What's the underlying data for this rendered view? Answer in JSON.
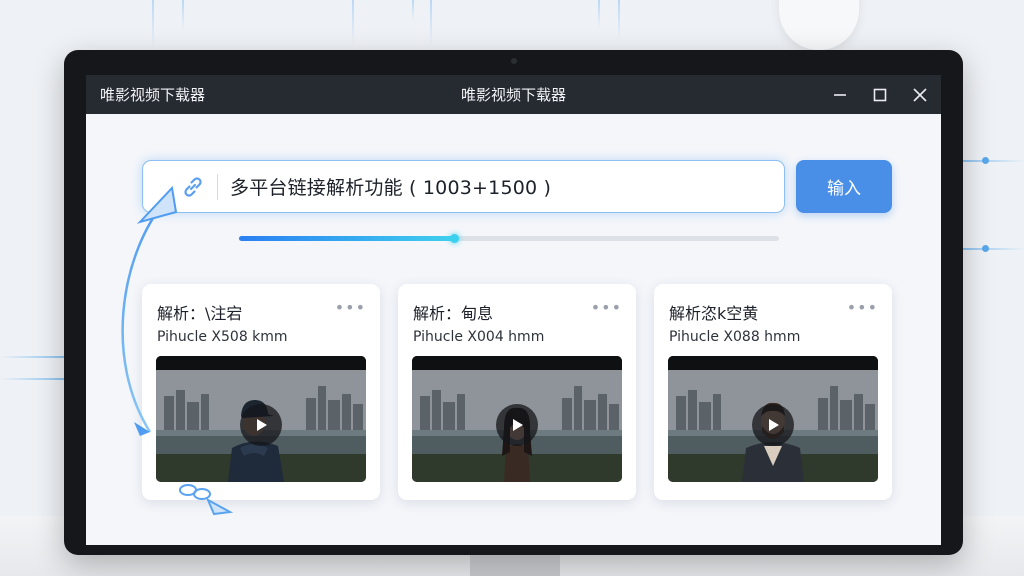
{
  "window": {
    "app_name": "唯影视频下载器",
    "title": "唯影视频下载器"
  },
  "search": {
    "value": "多平台链接解析功能 ( 1003+1500 )",
    "link_icon": "link-icon",
    "submit_label": "输入"
  },
  "progress": {
    "percent": 40
  },
  "cards": [
    {
      "title": "解析：\\注宕",
      "subtitle": "Pihucle X508 kmm",
      "more": "•••",
      "person": "man-cap"
    },
    {
      "title": "解析：甸息",
      "subtitle": "Pihucle X004 hmm",
      "more": "•••",
      "person": "woman"
    },
    {
      "title": "解析恣k空黄",
      "subtitle": "Pihucle X088 hmm",
      "more": "•••",
      "person": "man-beard"
    }
  ],
  "colors": {
    "accent": "#4a8fe7",
    "titlebar": "#262a31",
    "progress_start": "#2b7ff2",
    "progress_end": "#3fd0ee"
  }
}
